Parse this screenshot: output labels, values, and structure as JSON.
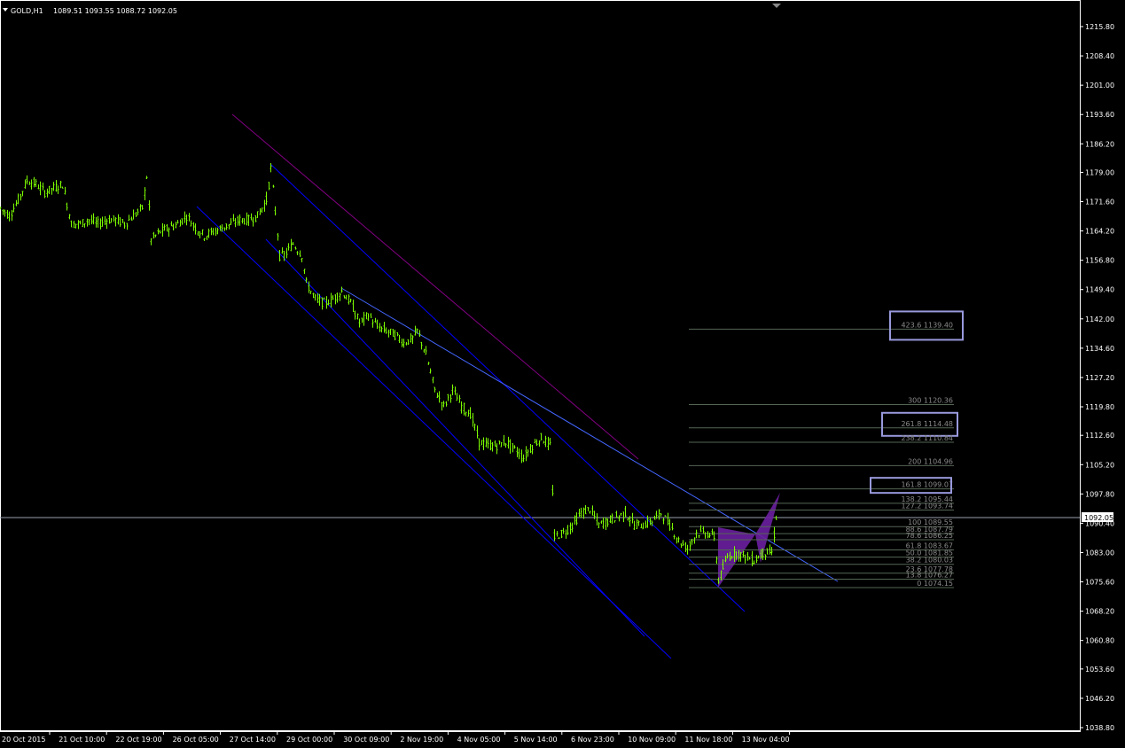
{
  "header": {
    "symbol": "GOLD,H1",
    "ohlc": "1089.51 1093.55 1088.72 1092.05"
  },
  "price_marker": "1092.05",
  "colors": {
    "background": "#000000",
    "candles": "#7CFC00",
    "channel": "#0000FF",
    "trendline": "#4466FF",
    "purple_line": "#800080",
    "fib_lines": "#556655",
    "fib_box": "#9999DD",
    "harmonic": "#6A1FA0",
    "axis": "#FFFFFF",
    "bid_line": "#9AA0B0"
  },
  "chart_data": {
    "type": "candlestick",
    "timeframe": "H1",
    "ylim": [
      1038.8,
      1219.6
    ],
    "y_ticks": [
      "1215.80",
      "1208.40",
      "1201.00",
      "1193.60",
      "1186.20",
      "1179.00",
      "1171.60",
      "1164.20",
      "1156.80",
      "1149.40",
      "1142.00",
      "1134.60",
      "1127.20",
      "1119.80",
      "1112.60",
      "1105.20",
      "1097.80",
      "1090.40",
      "1083.00",
      "1075.60",
      "1068.20",
      "1060.80",
      "1053.60",
      "1046.20",
      "1038.80"
    ],
    "x_ticks": [
      "20 Oct 2015",
      "21 Oct 10:00",
      "22 Oct 19:00",
      "26 Oct 05:00",
      "27 Oct 14:00",
      "29 Oct 00:00",
      "30 Oct 09:00",
      "2 Nov 19:00",
      "4 Nov 05:00",
      "5 Nov 14:00",
      "6 Nov 23:00",
      "10 Nov 09:00",
      "11 Nov 18:00",
      "13 Nov 04:00"
    ],
    "price_path": [
      [
        0,
        1170
      ],
      [
        10,
        1168
      ],
      [
        20,
        1172
      ],
      [
        30,
        1177
      ],
      [
        40,
        1176
      ],
      [
        50,
        1174
      ],
      [
        60,
        1175
      ],
      [
        70,
        1176
      ],
      [
        75,
        1171
      ],
      [
        80,
        1166
      ],
      [
        90,
        1166
      ],
      [
        100,
        1167
      ],
      [
        110,
        1166
      ],
      [
        120,
        1167
      ],
      [
        130,
        1167
      ],
      [
        140,
        1166
      ],
      [
        150,
        1168
      ],
      [
        160,
        1170
      ],
      [
        165,
        1178
      ],
      [
        170,
        1162
      ],
      [
        180,
        1164
      ],
      [
        190,
        1165
      ],
      [
        200,
        1166
      ],
      [
        210,
        1168
      ],
      [
        220,
        1165
      ],
      [
        230,
        1163
      ],
      [
        240,
        1164
      ],
      [
        250,
        1165
      ],
      [
        260,
        1166
      ],
      [
        270,
        1167
      ],
      [
        280,
        1167
      ],
      [
        290,
        1168
      ],
      [
        300,
        1172
      ],
      [
        305,
        1180
      ],
      [
        315,
        1158
      ],
      [
        320,
        1158
      ],
      [
        330,
        1161
      ],
      [
        340,
        1158
      ],
      [
        345,
        1151
      ],
      [
        355,
        1147
      ],
      [
        365,
        1146
      ],
      [
        375,
        1147
      ],
      [
        385,
        1149
      ],
      [
        395,
        1146
      ],
      [
        405,
        1141
      ],
      [
        415,
        1143
      ],
      [
        425,
        1140
      ],
      [
        435,
        1139
      ],
      [
        445,
        1138
      ],
      [
        455,
        1136
      ],
      [
        465,
        1137
      ],
      [
        470,
        1139
      ],
      [
        480,
        1133
      ],
      [
        490,
        1124
      ],
      [
        500,
        1120
      ],
      [
        510,
        1124
      ],
      [
        520,
        1120
      ],
      [
        530,
        1118
      ],
      [
        540,
        1111
      ],
      [
        550,
        1110
      ],
      [
        560,
        1110
      ],
      [
        570,
        1111
      ],
      [
        580,
        1109
      ],
      [
        590,
        1107
      ],
      [
        600,
        1110
      ],
      [
        610,
        1112
      ],
      [
        620,
        1110
      ],
      [
        625,
        1087
      ],
      [
        635,
        1088
      ],
      [
        645,
        1090
      ],
      [
        655,
        1093
      ],
      [
        665,
        1094
      ],
      [
        675,
        1090
      ],
      [
        685,
        1091
      ],
      [
        695,
        1092
      ],
      [
        705,
        1093
      ],
      [
        715,
        1090
      ],
      [
        725,
        1090
      ],
      [
        735,
        1091
      ],
      [
        745,
        1093
      ],
      [
        755,
        1090
      ],
      [
        765,
        1086
      ],
      [
        775,
        1084
      ],
      [
        785,
        1088
      ],
      [
        795,
        1088
      ],
      [
        805,
        1087
      ],
      [
        810,
        1076
      ],
      [
        820,
        1082
      ],
      [
        830,
        1083
      ],
      [
        840,
        1082
      ],
      [
        850,
        1081
      ],
      [
        860,
        1083
      ],
      [
        870,
        1083
      ],
      [
        875,
        1092
      ]
    ],
    "fib_levels": [
      {
        "label": "423.6 1139.40",
        "value": 1139.4,
        "boxed": true
      },
      {
        "label": "300 1120.36",
        "value": 1120.36,
        "boxed": false
      },
      {
        "label": "261.8 1114.48",
        "value": 1114.48,
        "boxed": true
      },
      {
        "label": "238.2 1110.84",
        "value": 1110.84,
        "boxed": false
      },
      {
        "label": "200 1104.96",
        "value": 1104.96,
        "boxed": false
      },
      {
        "label": "161.8 1099.07",
        "value": 1099.07,
        "boxed": true
      },
      {
        "label": "138.2 1095.44",
        "value": 1095.44,
        "boxed": false
      },
      {
        "label": "127.2 1093.74",
        "value": 1093.74,
        "boxed": false
      },
      {
        "label": "100 1089.55",
        "value": 1089.55,
        "boxed": false
      },
      {
        "label": "88.6 1087.79",
        "value": 1087.79,
        "boxed": false
      },
      {
        "label": "78.6 1086.25",
        "value": 1086.25,
        "boxed": false
      },
      {
        "label": "61.8 1083.67",
        "value": 1083.67,
        "boxed": false
      },
      {
        "label": "50.0 1081.85",
        "value": 1081.85,
        "boxed": false
      },
      {
        "label": "38.2 1080.03",
        "value": 1080.03,
        "boxed": false
      },
      {
        "label": "23.6 1077.78",
        "value": 1077.78,
        "boxed": false
      },
      {
        "label": "13.8 1076.27",
        "value": 1076.27,
        "boxed": false
      },
      {
        "label": "0 1074.15",
        "value": 1074.15,
        "boxed": false
      }
    ],
    "current_price": 1092.05
  }
}
